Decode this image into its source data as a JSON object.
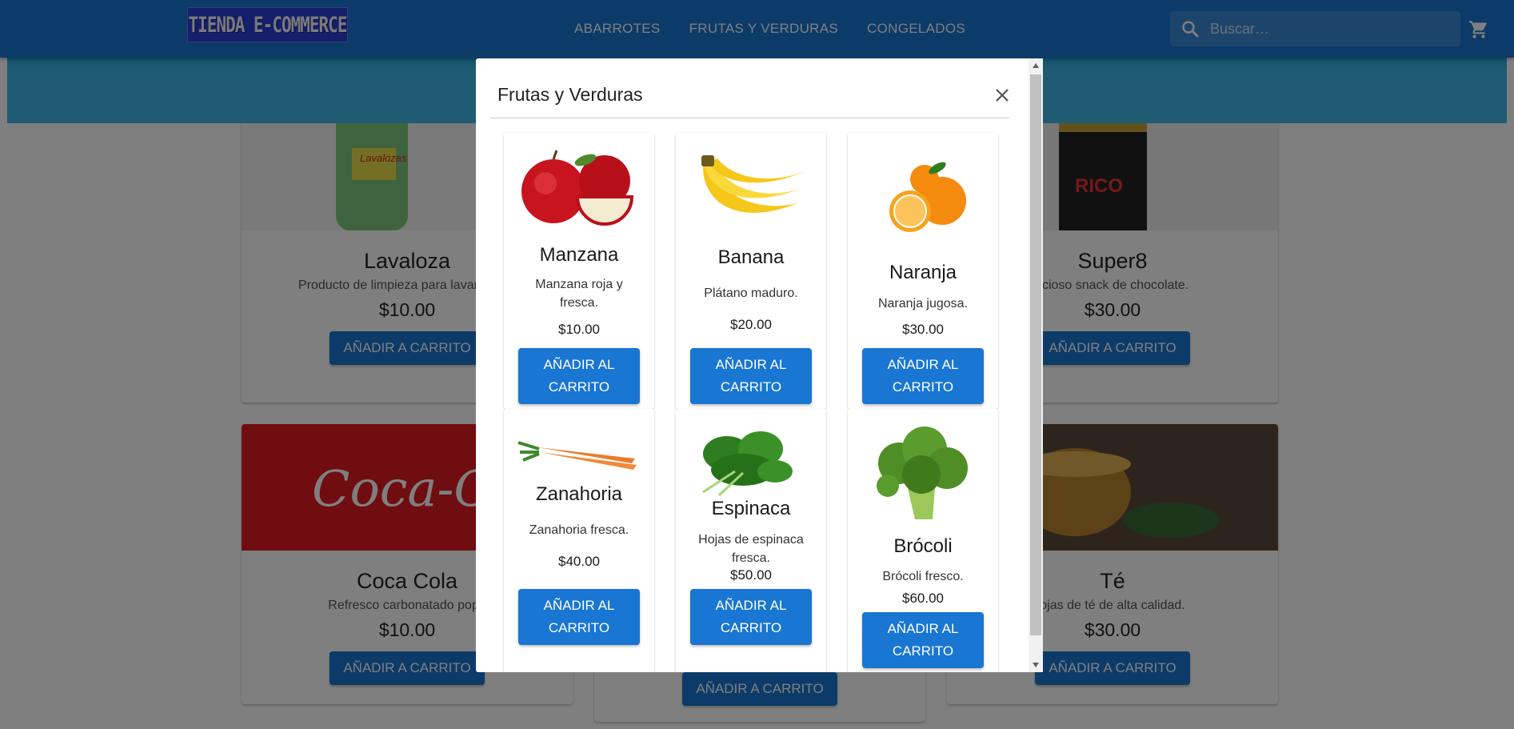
{
  "header": {
    "logo_text": "TIENDA E-COMMERCE",
    "nav": [
      "ABARROTES",
      "FRUTAS Y VERDURAS",
      "CONGELADOS"
    ],
    "search_placeholder": "Buscar…"
  },
  "background_products": [
    {
      "name": "Lavaloza",
      "description": "Producto de limpieza para lavar platos",
      "price": "$10.00",
      "button": "AÑADIR A CARRITO"
    },
    {
      "name": "Super8",
      "description": "licioso snack de chocolate.",
      "price": "$30.00",
      "button": "AÑADIR A CARRITO"
    },
    {
      "name": "Coca Cola",
      "description": "Refresco carbonatado popu",
      "price": "$10.00",
      "button": "AÑADIR A CARRITO"
    },
    {
      "name": "Té",
      "description": "ojas de té de alta calidad.",
      "price": "$30.00",
      "button": "AÑADIR A CARRITO"
    },
    {
      "name": "",
      "description": "",
      "price": "",
      "button": "AÑADIR A CARRITO"
    }
  ],
  "modal": {
    "title": "Frutas y Verduras",
    "products": [
      {
        "name": "Manzana",
        "description": "Manzana roja y fresca.",
        "price": "$10.00",
        "button": "AÑADIR AL CARRITO",
        "icon": "apple-image"
      },
      {
        "name": "Banana",
        "description": "Plátano maduro.",
        "price": "$20.00",
        "button": "AÑADIR AL CARRITO",
        "icon": "banana-image"
      },
      {
        "name": "Naranja",
        "description": "Naranja jugosa.",
        "price": "$30.00",
        "button": "AÑADIR AL CARRITO",
        "icon": "orange-image"
      },
      {
        "name": "Zanahoria",
        "description": "Zanahoria fresca.",
        "price": "$40.00",
        "button": "AÑADIR AL CARRITO",
        "icon": "carrot-image"
      },
      {
        "name": "Espinaca",
        "description": "Hojas de espinaca fresca.",
        "price": "$50.00",
        "button": "AÑADIR AL CARRITO",
        "icon": "spinach-image"
      },
      {
        "name": "Brócoli",
        "description": "Brócoli fresco.",
        "price": "$60.00",
        "button": "AÑADIR AL CARRITO",
        "icon": "broccoli-image"
      }
    ]
  },
  "colors": {
    "primary": "#1976d2",
    "banner": "#3fb8e6",
    "backdrop": "rgba(0,0,0,0.5)"
  }
}
